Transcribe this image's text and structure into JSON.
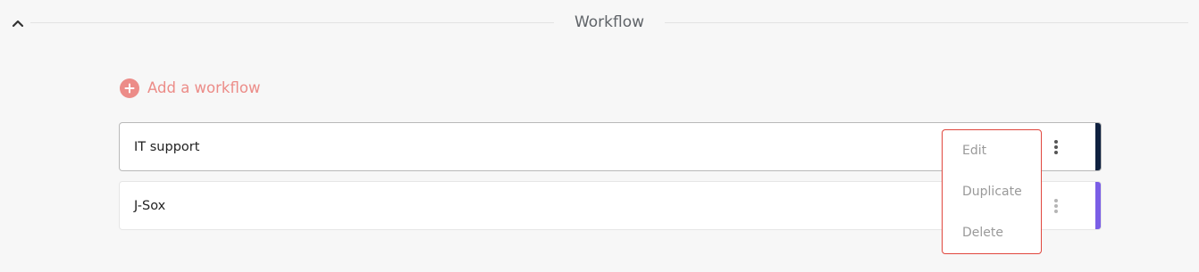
{
  "section": {
    "title": "Workflow",
    "collapse_icon": "chevron-up-icon"
  },
  "add_workflow": {
    "label": "Add a workflow",
    "icon": "plus-circle-icon",
    "color": "#ec8c88"
  },
  "workflows": [
    {
      "name": "IT support",
      "stripe_color": "#0f2140",
      "selected": true
    },
    {
      "name": "J-Sox",
      "stripe_color": "#7a5ee6",
      "selected": false
    }
  ],
  "context_menu": {
    "items": [
      {
        "label": "Edit"
      },
      {
        "label": "Duplicate"
      },
      {
        "label": "Delete"
      }
    ],
    "border_color": "#e0473e"
  }
}
